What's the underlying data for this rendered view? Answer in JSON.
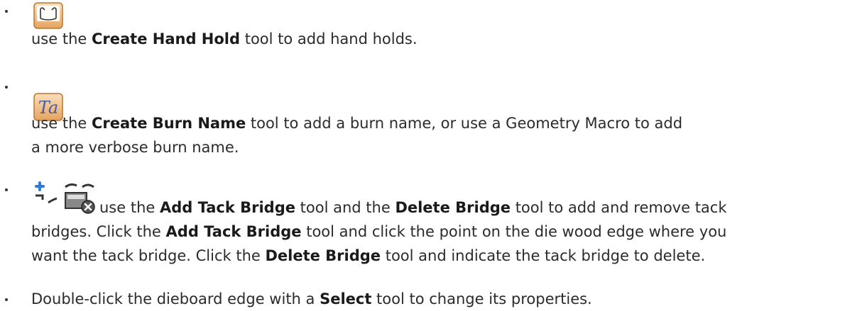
{
  "items": [
    {
      "icons": [
        "hand-hold-icon"
      ],
      "segments": [
        {
          "text": "use the ",
          "bold": false
        },
        {
          "text": "Create Hand Hold",
          "bold": true
        },
        {
          "text": " tool to add hand holds.",
          "bold": false
        }
      ]
    },
    {
      "icons": [
        "burn-name-icon"
      ],
      "segments": [
        {
          "text": "use the ",
          "bold": false
        },
        {
          "text": "Create Burn Name",
          "bold": true
        },
        {
          "text": " tool to add a burn name, or use a Geometry Macro to add",
          "bold": false
        },
        {
          "text": "a more verbose burn name.",
          "bold": false
        }
      ]
    },
    {
      "icons": [
        "add-tack-bridge-icon",
        "delete-bridge-icon"
      ],
      "segments": [
        {
          "text": "use the ",
          "bold": false
        },
        {
          "text": "Add Tack Bridge",
          "bold": true
        },
        {
          "text": " tool and the ",
          "bold": false
        },
        {
          "text": "Delete Bridge",
          "bold": true
        },
        {
          "text": " tool to add and remove tack",
          "bold": false
        },
        {
          "text": "bridges. Click the ",
          "bold": false
        },
        {
          "text": "Add Tack Bridge",
          "bold": true
        },
        {
          "text": " tool and click the point on the die wood edge where you",
          "bold": false
        },
        {
          "text": "want the tack bridge. Click the ",
          "bold": false
        },
        {
          "text": "Delete Bridge",
          "bold": true
        },
        {
          "text": " tool and indicate the tack bridge to delete.",
          "bold": false
        }
      ]
    },
    {
      "icons": [],
      "segments": [
        {
          "text": "Double-click the dieboard edge with a ",
          "bold": false
        },
        {
          "text": "Select",
          "bold": true
        },
        {
          "text": " tool to change its properties.",
          "bold": false
        }
      ]
    }
  ]
}
